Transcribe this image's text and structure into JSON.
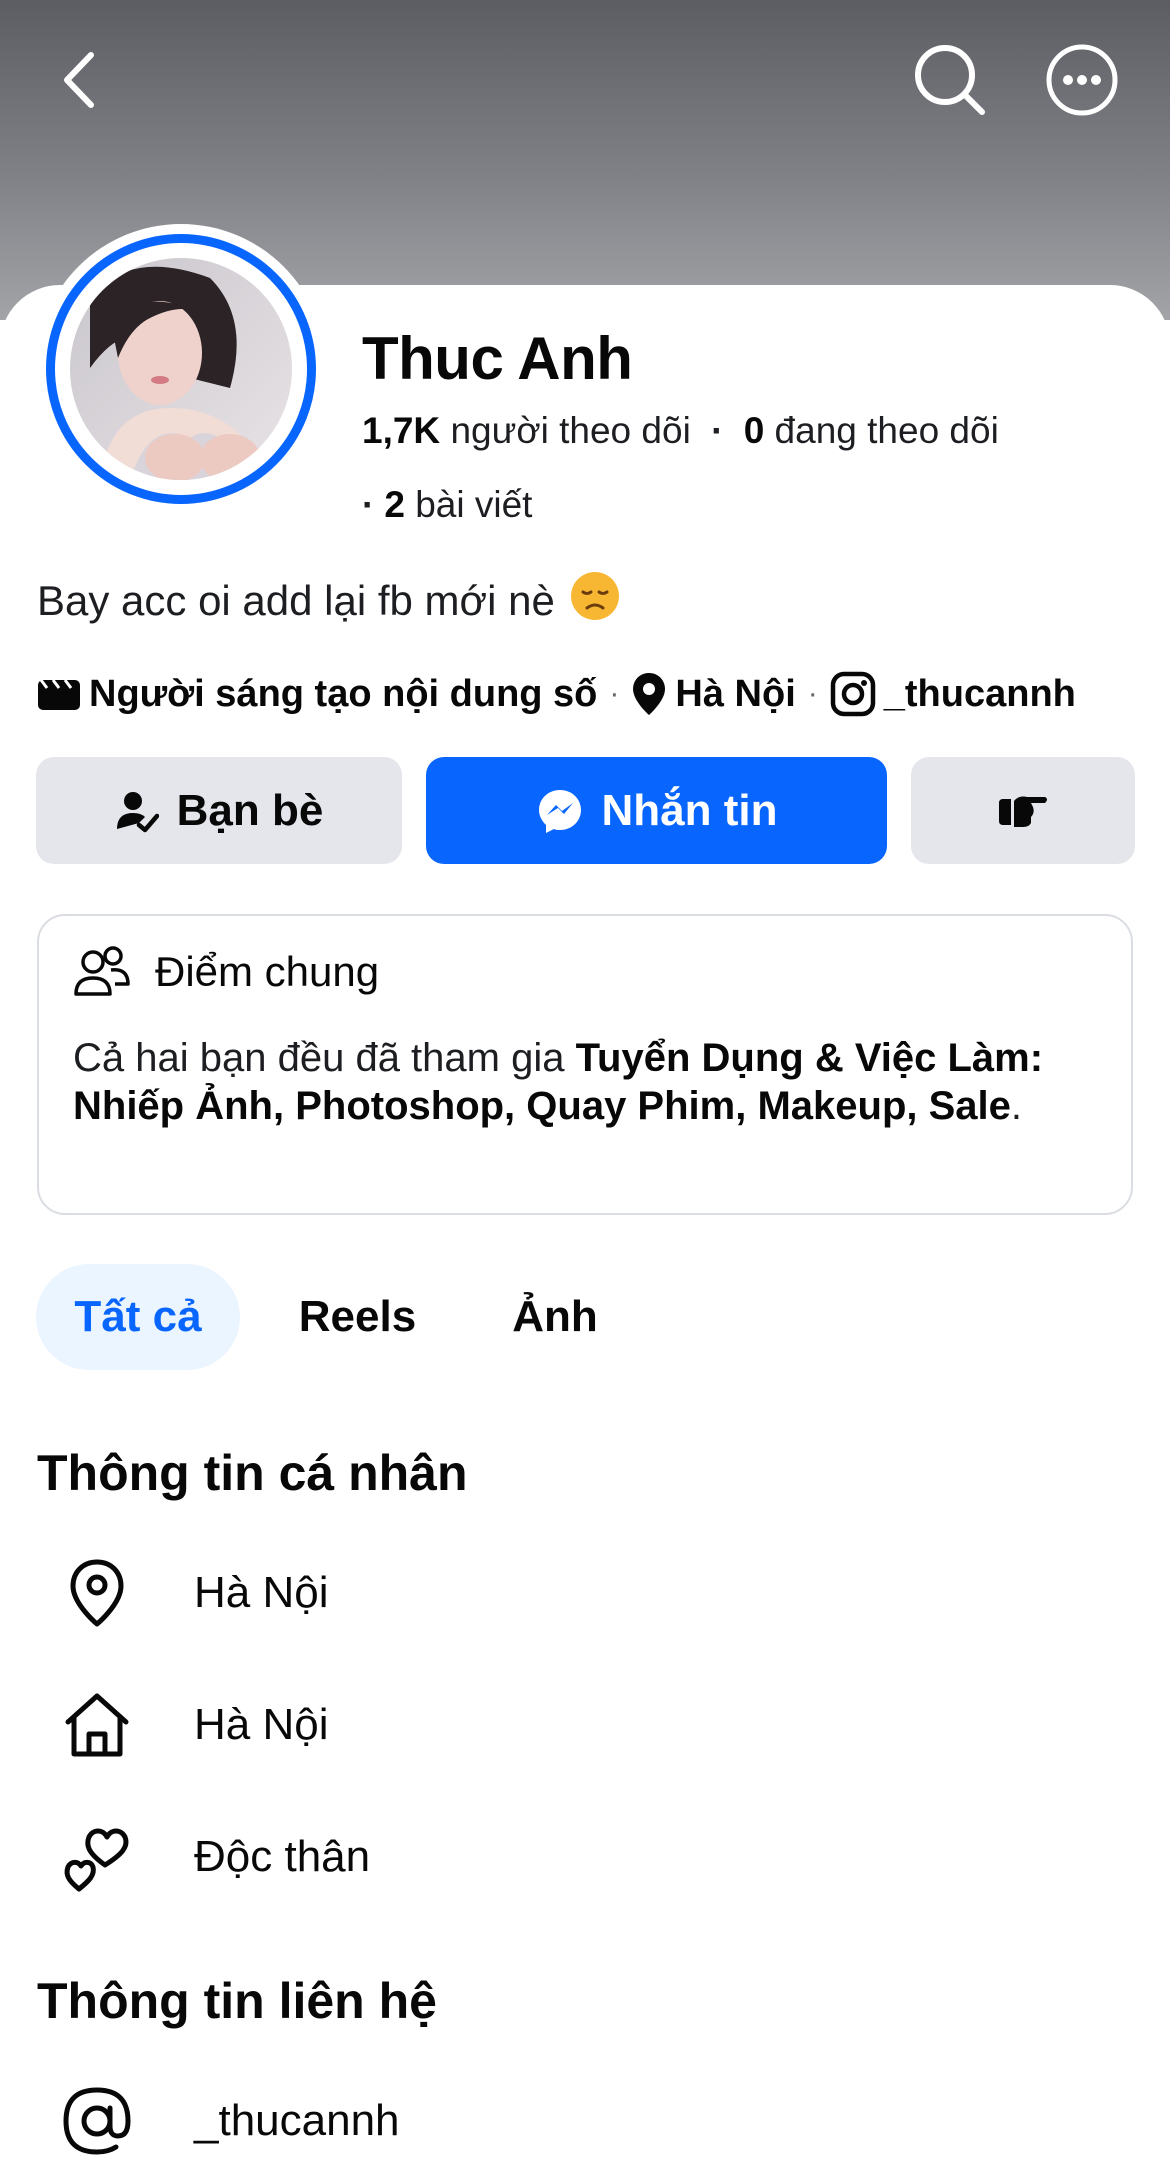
{
  "profile": {
    "name": "Thuc Anh",
    "followers_count": "1,7K",
    "followers_label": "người theo dõi",
    "following_count": "0",
    "following_label": "đang theo dõi",
    "posts_count": "2",
    "posts_label": "bài viết",
    "bio": "Bay acc oi add lại fb mới nè",
    "bio_emoji": "😞"
  },
  "info": {
    "category": "Người sáng tạo nội dung số",
    "location": "Hà Nội",
    "instagram": "_thucannh"
  },
  "actions": {
    "friends_label": "Bạn bè",
    "message_label": "Nhắn tin"
  },
  "common": {
    "title": "Điểm chung",
    "text_prefix": "Cả hai bạn đều đã tham gia ",
    "group_name": "Tuyển Dụng & Việc Làm: Nhiếp Ảnh, Photoshop, Quay Phim, Makeup, Sale",
    "text_suffix": "."
  },
  "tabs": [
    {
      "label": "Tất cả",
      "active": true
    },
    {
      "label": "Reels",
      "active": false
    },
    {
      "label": "Ảnh",
      "active": false
    }
  ],
  "personal_info": {
    "title": "Thông tin cá nhân",
    "items": [
      {
        "icon": "location-pin-icon",
        "text": "Hà Nội"
      },
      {
        "icon": "home-icon",
        "text": "Hà Nội"
      },
      {
        "icon": "hearts-icon",
        "text": "Độc thân"
      }
    ]
  },
  "contact_info": {
    "title": "Thông tin liên hệ",
    "items": [
      {
        "icon": "at-sign-icon",
        "text": "_thucannh"
      }
    ]
  },
  "colors": {
    "accent": "#0866ff",
    "button_gray": "#e4e6eb",
    "tab_active_bg": "#ebf5ff"
  }
}
